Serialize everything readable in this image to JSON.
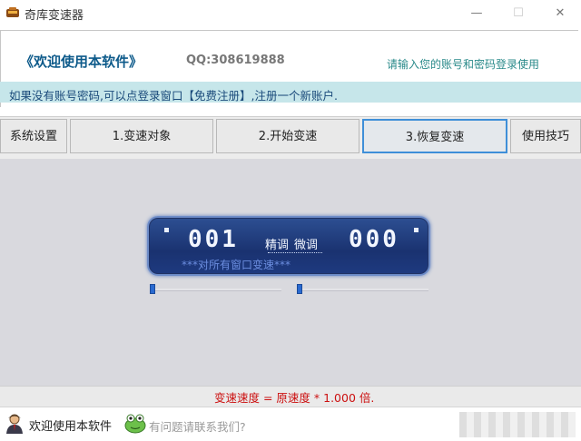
{
  "window": {
    "title": "奇库变速器",
    "minimize": "—",
    "maximize": "☐",
    "close": "✕"
  },
  "header": {
    "welcome": "《欢迎使用本软件》",
    "qq": "QQ:308619888",
    "login_hint": "请输入您的账号和密码登录使用",
    "notice": "如果没有账号密码,可以点登录窗口【免费注册】,注册一个新账户."
  },
  "tabs": [
    {
      "label": "系统设置"
    },
    {
      "label": "1.变速对象"
    },
    {
      "label": "2.开始变速"
    },
    {
      "label": "3.恢复变速",
      "active": true
    },
    {
      "label": "使用技巧"
    }
  ],
  "speed_panel": {
    "left_value": "001",
    "right_value": "000",
    "fine_label": "精调",
    "micro_label": "微调",
    "subtitle": "***对所有窗口变速***",
    "slider_left_level": 0,
    "slider_right_level": 0
  },
  "status": {
    "text": "变速速度 = 原速度 * 1.000 倍."
  },
  "footer": {
    "welcome": "欢迎使用本软件",
    "help_link": "有问题请联系我们?",
    "user_icon": "user-icon",
    "help_icon": "frog-help-icon"
  },
  "colors": {
    "accent": "#3f8fd8",
    "status_red": "#cc1111",
    "lcd_bg": "#1a3270",
    "notice_bg": "#c6e6ea"
  }
}
